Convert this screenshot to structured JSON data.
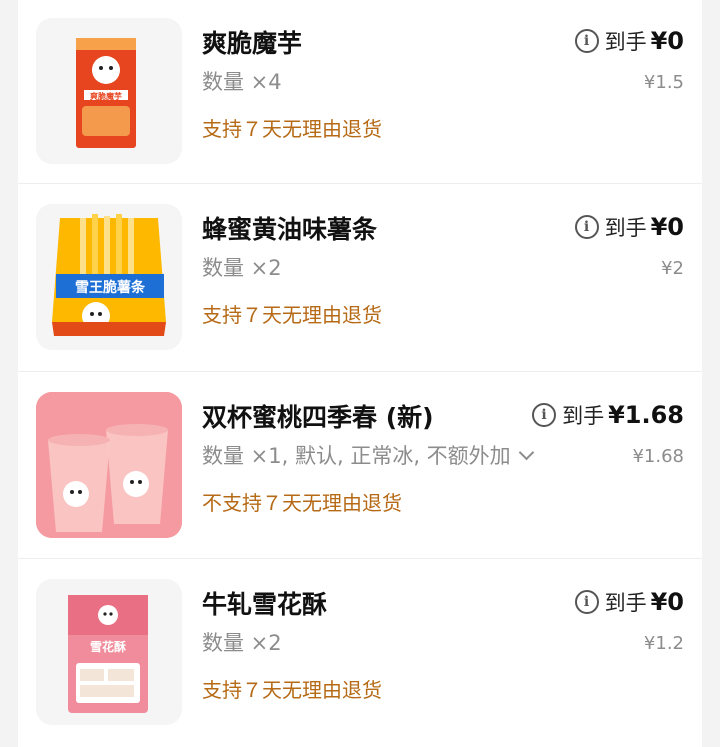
{
  "items": [
    {
      "title": "爽脆魔芋",
      "qty": "数量 ×4",
      "policy": "支持７天无理由退货",
      "receive_label": "到手",
      "receive_price": "¥0",
      "original_price": "¥1.5",
      "image_text": "爽脆魔芋"
    },
    {
      "title": "蜂蜜黄油味薯条",
      "qty": "数量 ×2",
      "policy": "支持７天无理由退货",
      "receive_label": "到手",
      "receive_price": "¥0",
      "original_price": "¥2",
      "image_text": "雪王脆薯条"
    },
    {
      "title": "双杯蜜桃四季春 (新)",
      "qty": "数量 ×1, 默认, 正常冰, 不额外加",
      "policy": "不支持７天无理由退货",
      "receive_label": "到手",
      "receive_price": "¥1.68",
      "original_price": "¥1.68"
    },
    {
      "title": "牛轧雪花酥",
      "qty": "数量 ×2",
      "policy": "支持７天无理由退货",
      "receive_label": "到手",
      "receive_price": "¥0",
      "original_price": "¥1.2",
      "image_text": "雪花酥"
    }
  ],
  "colors": {
    "policy": "#b66a16",
    "muted": "#8c8c8c",
    "title": "#111111"
  }
}
